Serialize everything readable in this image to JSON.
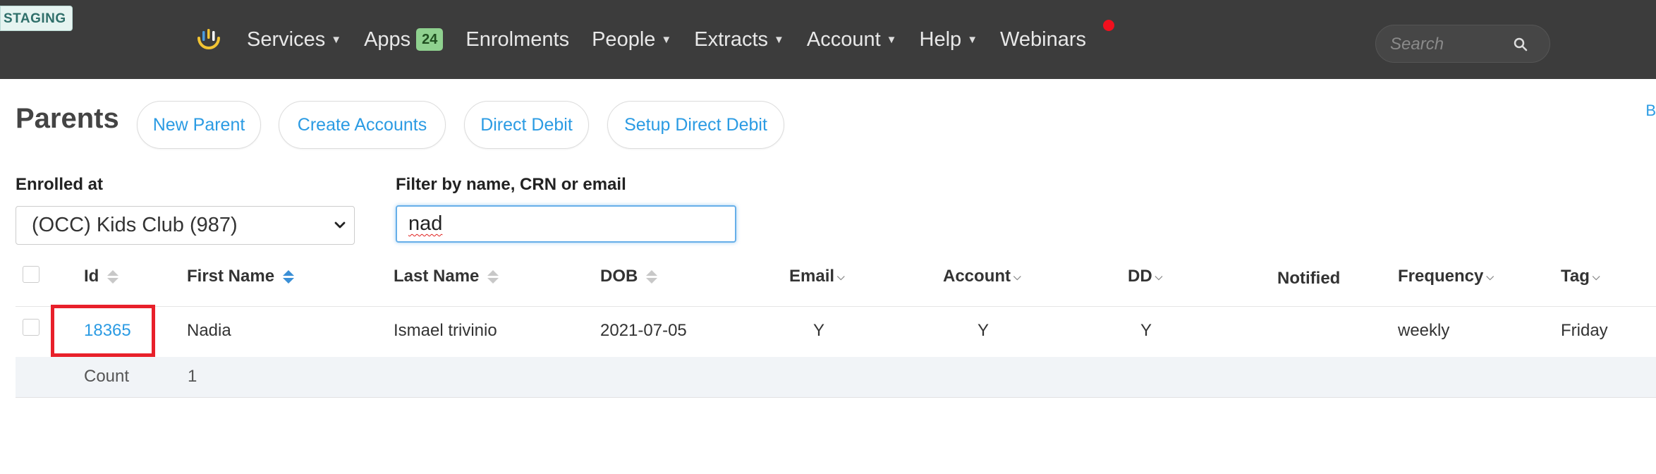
{
  "env_badge": "STAGING",
  "nav": {
    "items": [
      {
        "label": "Services",
        "caret": true
      },
      {
        "label": "Apps",
        "badge": "24"
      },
      {
        "label": "Enrolments"
      },
      {
        "label": "People",
        "caret": true
      },
      {
        "label": "Extracts",
        "caret": true
      },
      {
        "label": "Account",
        "caret": true
      },
      {
        "label": "Help",
        "caret": true
      },
      {
        "label": "Webinars"
      }
    ],
    "search_placeholder": "Search"
  },
  "corner_link": "B",
  "page": {
    "title": "Parents",
    "buttons": [
      "New Parent",
      "Create Accounts",
      "Direct Debit",
      "Setup Direct Debit"
    ]
  },
  "filters": {
    "enrolled_label": "Enrolled at",
    "enrolled_value": "(OCC) Kids Club (987)",
    "filter_label": "Filter by name, CRN or email",
    "filter_value": "nad"
  },
  "table": {
    "columns": [
      "Id",
      "First Name",
      "Last Name",
      "DOB",
      "Email",
      "Account",
      "DD",
      "Notified",
      "Frequency",
      "Tag"
    ],
    "rows": [
      {
        "id": "18365",
        "first_name": "Nadia",
        "last_name": "Ismael trivinio",
        "dob": "2021-07-05",
        "email": "Y",
        "account": "Y",
        "dd": "Y",
        "notified": "",
        "frequency": "weekly",
        "tag": "Friday"
      }
    ],
    "count_label": "Count",
    "count_value": "1"
  },
  "colors": {
    "topbar": "#3c3c3c",
    "link": "#2b9be3",
    "highlight": "#e8202a",
    "badge": "#8fd18f"
  }
}
